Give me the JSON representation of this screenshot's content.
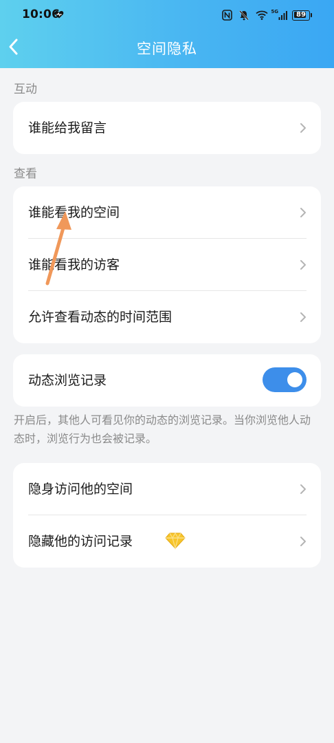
{
  "status_bar": {
    "time": "10:06",
    "network": "5G",
    "battery": "89",
    "battery_level": 0.89,
    "icons": [
      "heart-icon",
      "nfc-icon",
      "mute-bell-icon",
      "wifi-icon",
      "signal-icon",
      "battery-icon"
    ]
  },
  "nav": {
    "back_icon": "chevron-left-icon",
    "title": "空间隐私"
  },
  "sections": {
    "interaction_label": "互动",
    "view_label": "查看"
  },
  "interaction_items": [
    {
      "label": "谁能给我留言"
    }
  ],
  "view_items": [
    {
      "label": "谁能看我的空间"
    },
    {
      "label": "谁能看我的访客"
    },
    {
      "label": "允许查看动态的时间范围"
    }
  ],
  "browse_record": {
    "label": "动态浏览记录",
    "enabled": true,
    "hint": "开启后，其他人可看见你的动态的浏览记录。当你浏览他人动态时，浏览行为也会被记录。"
  },
  "visit_items": [
    {
      "label": "隐身访问他的空间"
    },
    {
      "label": "隐藏他的访问记录",
      "badge_icon": "diamond-icon"
    }
  ],
  "colors": {
    "header_gradient_start": "#5ed0ee",
    "header_gradient_end": "#3aa7f3",
    "toggle_on": "#3d8eea",
    "annotation_arrow": "#f0985a",
    "diamond": "#f7c52c"
  }
}
